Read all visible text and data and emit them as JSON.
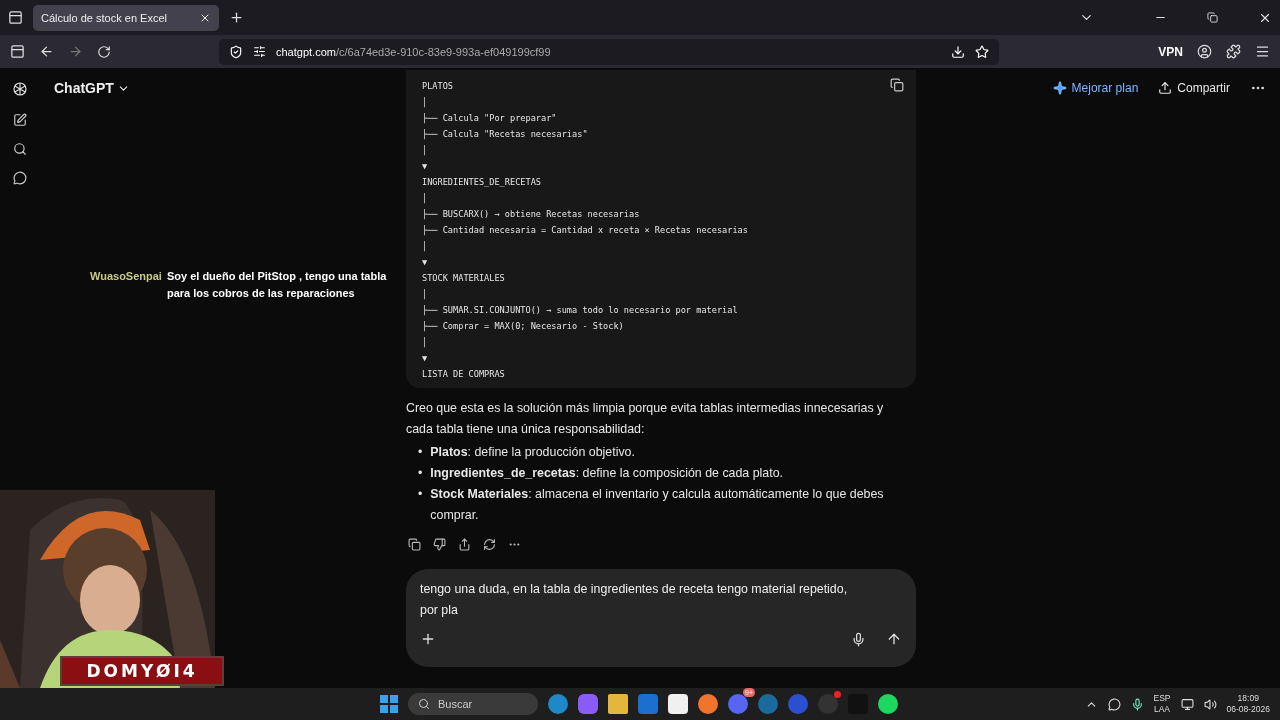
{
  "browser": {
    "tab": {
      "title": "Cálculo de stock en Excel",
      "selected": true
    },
    "url_host": "chatgpt.com",
    "url_path": "/c/6a74ed3e-910c-83e9-993a-ef049199cf99",
    "vpn_label": "VPN"
  },
  "header": {
    "title": "ChatGPT",
    "upgrade": "Mejorar plan",
    "share": "Compartir"
  },
  "code_block": {
    "lines": [
      "PLATOS",
      "│",
      "├── Calcula \"Por preparar\"",
      "├── Calcula \"Recetas necesarias\"",
      "│",
      "▼",
      "INGREDIENTES_DE_RECETAS",
      "│",
      "├── BUSCARX() → obtiene Recetas necesarias",
      "├── Cantidad necesaria = Cantidad x receta × Recetas necesarias",
      "│",
      "▼",
      "STOCK MATERIALES",
      "│",
      "├── SUMAR.SI.CONJUNTO() → suma todo lo necesario por material",
      "├── Comprar = MAX(0; Necesario - Stock)",
      "│",
      "▼",
      "LISTA DE COMPRAS"
    ]
  },
  "answer": {
    "paragraph": "Creo que esta es la solución más limpia porque evita tablas intermedias innecesarias y cada tabla tiene una única responsabilidad:",
    "bullets": [
      {
        "marker": "•",
        "text": "**Platos**: define la producción objetivo."
      },
      {
        "marker": "•",
        "text": "**Ingredientes_de_recetas**: define la composición de cada plato."
      },
      {
        "marker": "•",
        "text": "**Stock Materiales**: almacena el inventario y calcula automáticamente lo que debes comprar."
      }
    ]
  },
  "composer": {
    "value": "tengo una duda, en la tabla de ingredientes de receta tengo material repetido, por pla"
  },
  "stream_chat": {
    "user": "WuasoSenpai",
    "message": "Soy el dueño del PitStop , tengo una tabla para los cobros de las reparaciones"
  },
  "webcam": {
    "kind": "picture",
    "banner": "DOMYØI4"
  },
  "taskbar": {
    "search_placeholder": "Buscar",
    "discord_badge": "9+",
    "language": "ESP",
    "layout": "LAA",
    "time": "18:09",
    "date": "06-08-2026"
  }
}
